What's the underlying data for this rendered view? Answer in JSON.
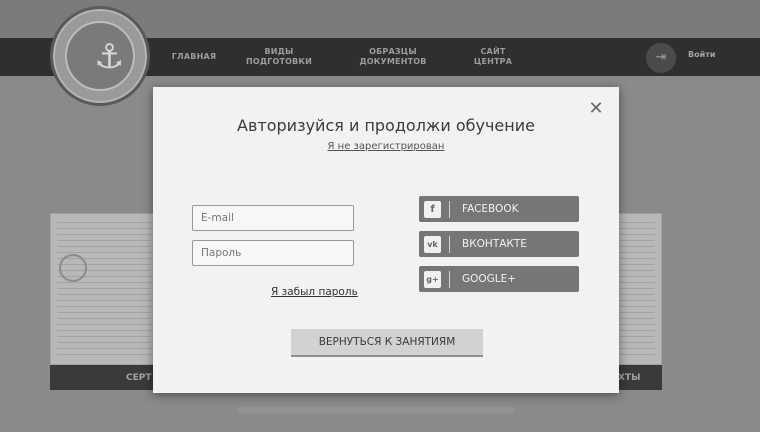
{
  "nav": {
    "items": [
      {
        "label": "ГЛАВНАЯ"
      },
      {
        "label": "ВИДЫ ПОДГОТОВКИ"
      },
      {
        "label": "ОБРАЗЦЫ ДОКУМЕНТОВ"
      },
      {
        "label": "САЙТ ЦЕНТРА"
      }
    ],
    "login_label": "Войти"
  },
  "background": {
    "left_bar_text": "СЕРТ",
    "right_bar_text": "ХТЫ"
  },
  "modal": {
    "title": "Авторизуйся и продолжи обучение",
    "register_link": "Я не зарегистрирован",
    "email_placeholder": "E-mail",
    "password_placeholder": "Пароль",
    "forgot_link": "Я забыл пароль",
    "social": [
      {
        "label": "FACEBOOK",
        "icon": "facebook-icon",
        "glyph": "f"
      },
      {
        "label": "ВКОНТАКТЕ",
        "icon": "vk-icon",
        "glyph": "vk"
      },
      {
        "label": "GOOGLE+",
        "icon": "google-plus-icon",
        "glyph": "g+"
      }
    ],
    "back_button": "ВЕРНУТЬСЯ К ЗАНЯТИЯМ",
    "close_icon": "close-icon"
  }
}
